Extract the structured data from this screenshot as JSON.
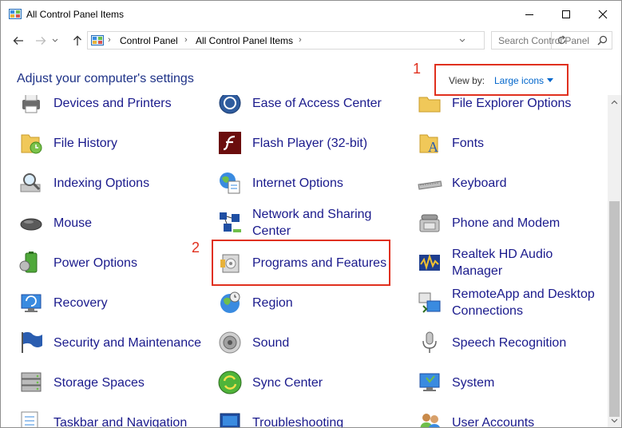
{
  "window": {
    "title": "All Control Panel Items"
  },
  "address": {
    "crumbs": [
      "Control Panel",
      "All Control Panel Items"
    ],
    "search_placeholder": "Search Control Panel"
  },
  "header": {
    "title": "Adjust your computer's settings",
    "view_by_label": "View by:",
    "view_by_value": "Large icons"
  },
  "annotations": [
    "1",
    "2"
  ],
  "items": [
    {
      "label": "Devices and Printers",
      "icon": "printer-icon"
    },
    {
      "label": "Ease of Access Center",
      "icon": "ease-of-access-icon"
    },
    {
      "label": "File Explorer Options",
      "icon": "folder-options-icon"
    },
    {
      "label": "File History",
      "icon": "file-history-icon"
    },
    {
      "label": "Flash Player (32-bit)",
      "icon": "flash-icon"
    },
    {
      "label": "Fonts",
      "icon": "fonts-icon"
    },
    {
      "label": "Indexing Options",
      "icon": "indexing-icon"
    },
    {
      "label": "Internet Options",
      "icon": "internet-options-icon"
    },
    {
      "label": "Keyboard",
      "icon": "keyboard-icon"
    },
    {
      "label": "Mouse",
      "icon": "mouse-icon"
    },
    {
      "label": "Network and Sharing Center",
      "icon": "network-icon"
    },
    {
      "label": "Phone and Modem",
      "icon": "phone-icon"
    },
    {
      "label": "Power Options",
      "icon": "power-icon"
    },
    {
      "label": "Programs and Features",
      "icon": "programs-icon"
    },
    {
      "label": "Realtek HD Audio Manager",
      "icon": "realtek-icon"
    },
    {
      "label": "Recovery",
      "icon": "recovery-icon"
    },
    {
      "label": "Region",
      "icon": "region-icon"
    },
    {
      "label": "RemoteApp and Desktop Connections",
      "icon": "remoteapp-icon"
    },
    {
      "label": "Security and Maintenance",
      "icon": "security-flag-icon"
    },
    {
      "label": "Sound",
      "icon": "speaker-icon"
    },
    {
      "label": "Speech Recognition",
      "icon": "microphone-icon"
    },
    {
      "label": "Storage Spaces",
      "icon": "storage-icon"
    },
    {
      "label": "Sync Center",
      "icon": "sync-icon"
    },
    {
      "label": "System",
      "icon": "system-icon"
    },
    {
      "label": "Taskbar and Navigation",
      "icon": "taskbar-icon"
    },
    {
      "label": "Troubleshooting",
      "icon": "troubleshooting-icon"
    },
    {
      "label": "User Accounts",
      "icon": "users-icon"
    }
  ],
  "colors": {
    "link": "#1a1a8c",
    "header": "#1e3287",
    "annotation": "#e0301e",
    "accent": "#0066cc"
  }
}
